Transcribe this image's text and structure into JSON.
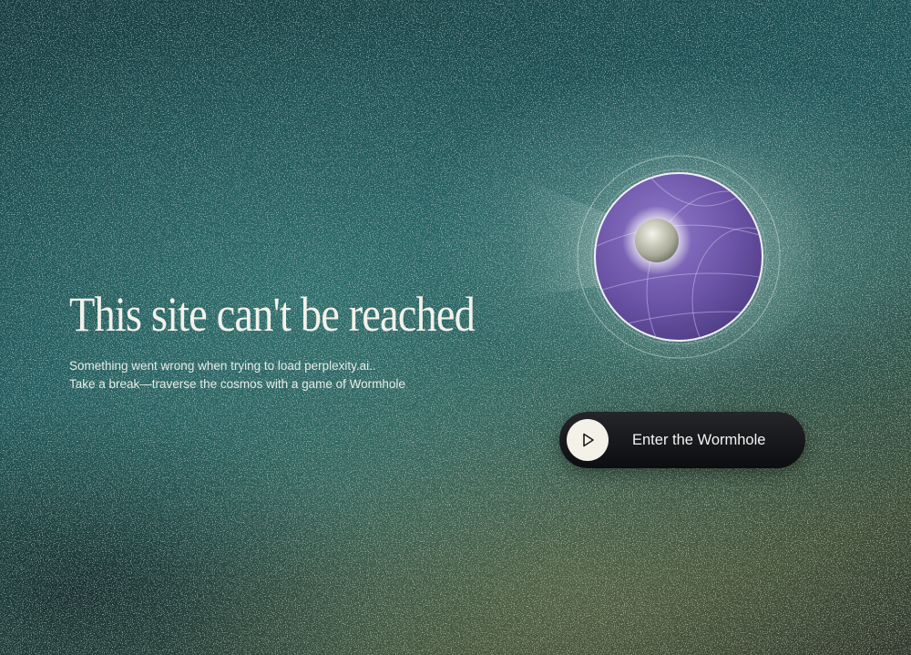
{
  "page": {
    "title": "This site can't be reached",
    "subtitle_line1": "Something went wrong when trying to load perplexity.ai..",
    "subtitle_line2": "Take a break—traverse the cosmos with a game of Wormhole"
  },
  "cta": {
    "label": "Enter the Wormhole",
    "icon": "play-icon"
  },
  "illustration": {
    "icon": "wormhole-planet-icon"
  },
  "colors": {
    "background_teal": "#1e5457",
    "planet_purple": "#6b54a6",
    "button_dark": "#111215",
    "button_icon_bg": "#f4f1e8",
    "text": "#f2f1ea"
  }
}
